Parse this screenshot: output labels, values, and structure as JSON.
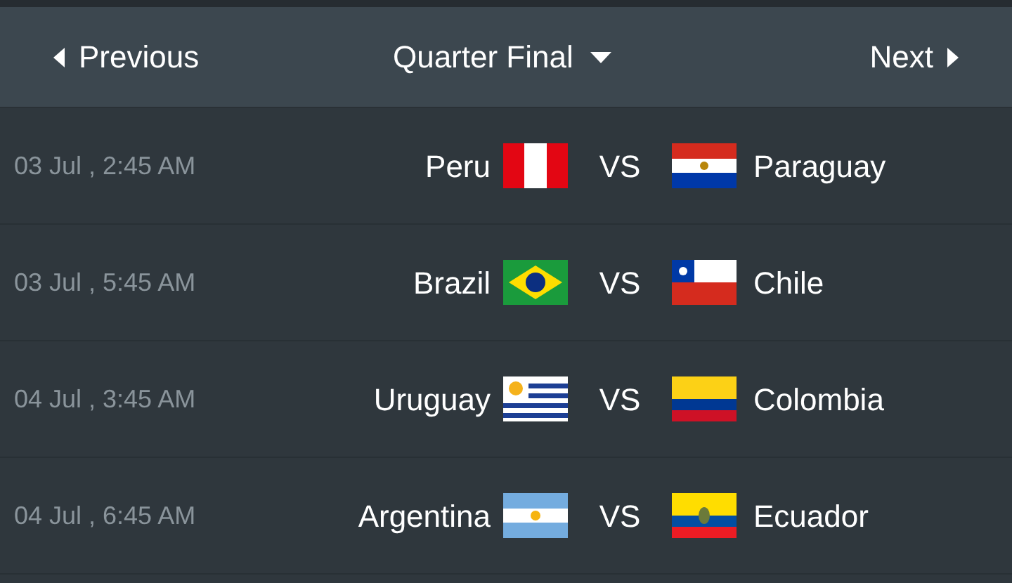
{
  "nav": {
    "previous": "Previous",
    "round": "Quarter Final",
    "next": "Next"
  },
  "matches": [
    {
      "time": "03 Jul , 2:45 AM",
      "home": {
        "name": "Peru",
        "flag": {
          "kind": "peru"
        }
      },
      "vs": "VS",
      "away": {
        "name": "Paraguay",
        "flag": {
          "kind": "paraguay"
        }
      }
    },
    {
      "time": "03 Jul , 5:45 AM",
      "home": {
        "name": "Brazil",
        "flag": {
          "kind": "brazil"
        }
      },
      "vs": "VS",
      "away": {
        "name": "Chile",
        "flag": {
          "kind": "chile"
        }
      }
    },
    {
      "time": "04 Jul , 3:45 AM",
      "home": {
        "name": "Uruguay",
        "flag": {
          "kind": "uruguay"
        }
      },
      "vs": "VS",
      "away": {
        "name": "Colombia",
        "flag": {
          "kind": "colombia"
        }
      }
    },
    {
      "time": "04 Jul , 6:45 AM",
      "home": {
        "name": "Argentina",
        "flag": {
          "kind": "argentina"
        }
      },
      "vs": "VS",
      "away": {
        "name": "Ecuador",
        "flag": {
          "kind": "ecuador"
        }
      }
    }
  ]
}
